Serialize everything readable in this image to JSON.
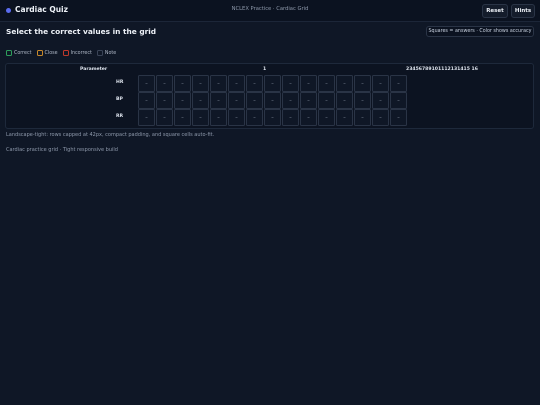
{
  "header": {
    "brand": "Cardiac Quiz",
    "subtitle": "NCLEX Practice · Cardiac Grid",
    "reset_label": "Reset",
    "hints_label": "Hints"
  },
  "page": {
    "title": "Select the correct values in the grid",
    "info_badge": "Squares = answers · Color shows accuracy"
  },
  "legend": [
    {
      "label": "Correct",
      "color": "#2e9e5b"
    },
    {
      "label": "Close",
      "color": "#c8892b"
    },
    {
      "label": "Incorrect",
      "color": "#c0392b"
    },
    {
      "label": "Note",
      "color": "#3a4457"
    }
  ],
  "grid": {
    "param_header": "Parameter",
    "col1_header": "1",
    "rest_header": "23456789101112131415 16",
    "rows": [
      {
        "label": "HR",
        "cells": [
          "–",
          "–",
          "–",
          "–",
          "–",
          "–",
          "–",
          "–",
          "–",
          "–",
          "–",
          "–",
          "–",
          "–",
          "–"
        ]
      },
      {
        "label": "BP",
        "cells": [
          "–",
          "–",
          "–",
          "–",
          "–",
          "–",
          "–",
          "–",
          "–",
          "–",
          "–",
          "–",
          "–",
          "–",
          "–"
        ]
      },
      {
        "label": "RR",
        "cells": [
          "–",
          "–",
          "–",
          "–",
          "–",
          "–",
          "–",
          "–",
          "–",
          "–",
          "–",
          "–",
          "–",
          "–",
          "–"
        ]
      }
    ]
  },
  "notes": {
    "layout_note": "Landscape-tight: rows capped at 42px, compact padding, and square cells auto-fit.",
    "footer": "Cardiac practice grid · Tight responsive build"
  }
}
